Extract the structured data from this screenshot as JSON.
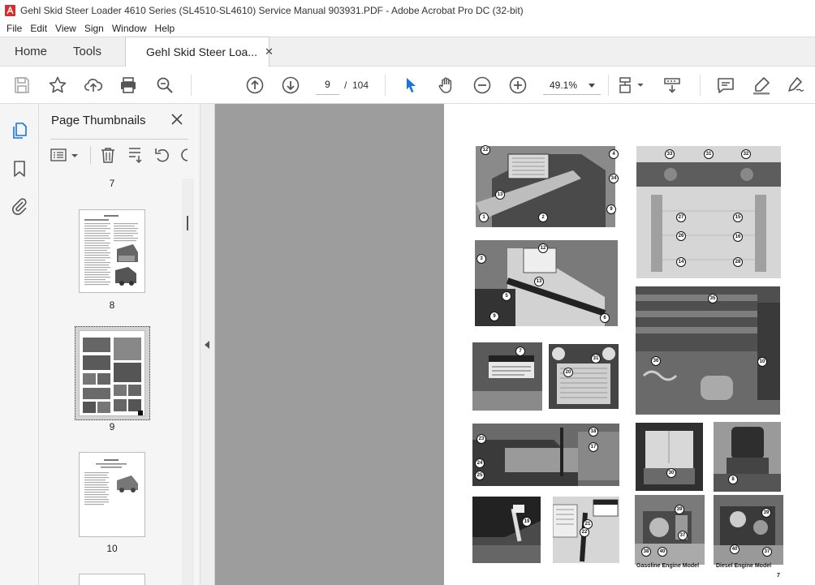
{
  "window": {
    "title": "Gehl Skid Steer Loader 4610 Series (SL4510-SL4610) Service Manual 903931.PDF - Adobe Acrobat Pro DC (32-bit)"
  },
  "menu": [
    "File",
    "Edit",
    "View",
    "Sign",
    "Window",
    "Help"
  ],
  "tabs": {
    "home": "Home",
    "tools": "Tools",
    "document": "Gehl Skid Steer Loa..."
  },
  "toolbar": {
    "icons": [
      "save-icon",
      "star-icon",
      "upload-icon",
      "print-icon",
      "zoom-search-icon",
      "arrow-up-icon",
      "arrow-down-icon",
      "select-arrow-icon",
      "hand-icon",
      "zoom-out-icon",
      "zoom-in-icon",
      "fit-page-icon",
      "scroll-mode-icon",
      "comment-icon",
      "highlight-icon",
      "sign-icon"
    ],
    "page_current": "9",
    "page_separator": "/",
    "page_total": "104",
    "zoom": "49.1%"
  },
  "thumbnails_panel": {
    "title": "Page Thumbnails",
    "pages": [
      {
        "number": "7"
      },
      {
        "number": "8"
      },
      {
        "number": "9",
        "selected": true
      },
      {
        "number": "10"
      }
    ]
  },
  "document_page": {
    "captions": {
      "gasoline": "Gasoline Engine Model",
      "diesel": "Diesel Engine Model",
      "page_number": "7"
    },
    "callouts": [
      "12",
      "4",
      "34",
      "13",
      "1",
      "2",
      "9",
      "33",
      "31",
      "32",
      "27",
      "26",
      "15",
      "16",
      "14",
      "28",
      "3",
      "12",
      "13",
      "5",
      "9",
      "6",
      "35",
      "7",
      "31",
      "20",
      "36",
      "10",
      "23",
      "24",
      "25",
      "18",
      "17",
      "30",
      "8",
      "19",
      "21",
      "22",
      "39",
      "37",
      "38",
      "40",
      "39",
      "40",
      "37"
    ]
  },
  "colors": {
    "acrobat_red": "#d32f2f",
    "select_blue": "#1473e6",
    "canvas_gray": "#9d9d9d"
  }
}
